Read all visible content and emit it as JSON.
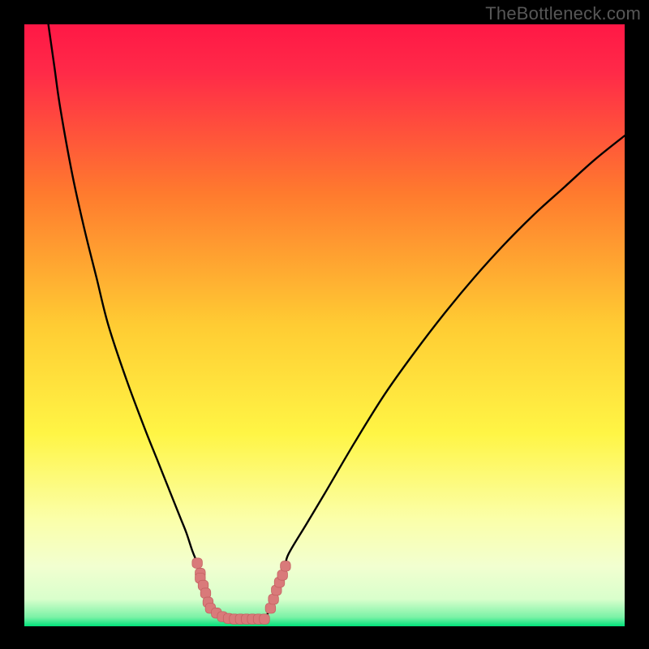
{
  "watermark": "TheBottleneck.com",
  "colors": {
    "background_black": "#000000",
    "gradient_top": "#ff1846",
    "gradient_mid_orange": "#ff8a2b",
    "gradient_mid_yellow": "#ffe93a",
    "gradient_pale": "#f7ffae",
    "gradient_green": "#00e57c",
    "curve_stroke": "#000000",
    "marker_fill": "#d97a7a",
    "marker_stroke": "#c46262"
  },
  "chart_data": {
    "type": "line",
    "title": "",
    "xlabel": "",
    "ylabel": "",
    "xlim": [
      0,
      100
    ],
    "ylim": [
      0,
      100
    ],
    "series": [
      {
        "name": "left-branch",
        "x": [
          4,
          5,
          6,
          8,
          10,
          12,
          14,
          17,
          20,
          22,
          24,
          26,
          27,
          28,
          28.8,
          29.3,
          29.8,
          30.2,
          30.6,
          31,
          33,
          36,
          40
        ],
        "values": [
          100,
          93,
          86,
          75,
          66,
          58,
          50,
          41,
          33,
          28,
          23,
          18,
          15.5,
          12.5,
          10.5,
          8.8,
          6.8,
          5.5,
          4,
          3,
          1.6,
          1.2,
          1.2
        ]
      },
      {
        "name": "right-branch",
        "x": [
          40,
          41,
          41.5,
          42,
          42.5,
          43,
          43.5,
          44,
          47,
          50,
          55,
          60,
          65,
          70,
          75,
          80,
          85,
          90,
          95,
          100
        ],
        "values": [
          1.2,
          3,
          4.5,
          6,
          7.3,
          8.5,
          10,
          12,
          17,
          22,
          30.5,
          38.5,
          45.5,
          52,
          58,
          63.5,
          68.5,
          73,
          77.5,
          81.5
        ]
      }
    ],
    "markers": {
      "name": "bottleneck-points",
      "x": [
        28.8,
        29.3,
        29.3,
        29.8,
        30.2,
        30.6,
        31,
        32,
        33,
        34,
        35,
        36,
        37,
        38,
        39,
        40,
        41,
        41.5,
        42,
        42.5,
        43,
        43.5
      ],
      "values": [
        10.5,
        8.8,
        8.0,
        6.8,
        5.5,
        4,
        3,
        2.2,
        1.6,
        1.3,
        1.2,
        1.2,
        1.2,
        1.2,
        1.2,
        1.2,
        3,
        4.5,
        6,
        7.3,
        8.5,
        10
      ]
    },
    "gradient_stops": [
      {
        "offset": 0.0,
        "color": "#ff1846"
      },
      {
        "offset": 0.08,
        "color": "#ff2a48"
      },
      {
        "offset": 0.28,
        "color": "#ff7a2e"
      },
      {
        "offset": 0.5,
        "color": "#ffcc33"
      },
      {
        "offset": 0.68,
        "color": "#fff545"
      },
      {
        "offset": 0.82,
        "color": "#fbffa8"
      },
      {
        "offset": 0.9,
        "color": "#f2ffd0"
      },
      {
        "offset": 0.955,
        "color": "#d9ffcc"
      },
      {
        "offset": 0.985,
        "color": "#7af2a6"
      },
      {
        "offset": 1.0,
        "color": "#00e27a"
      }
    ]
  }
}
